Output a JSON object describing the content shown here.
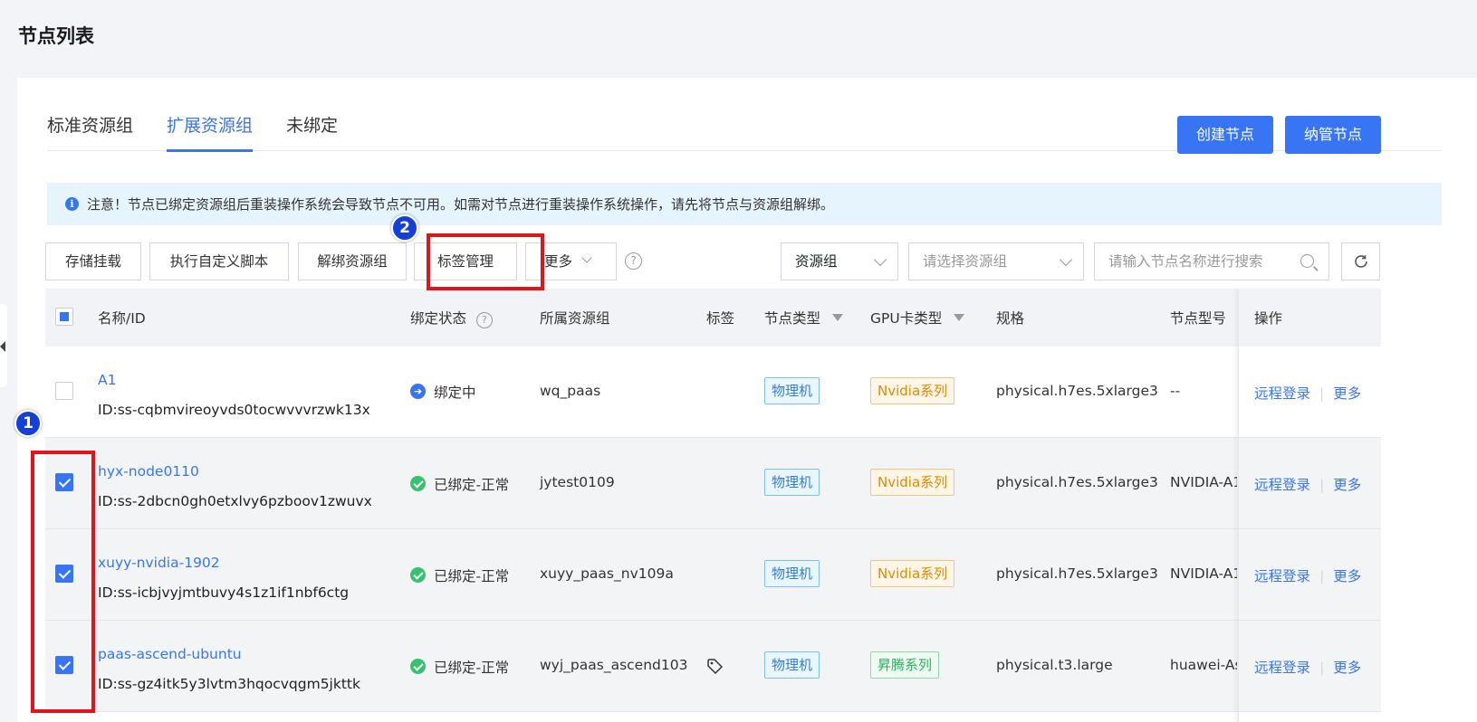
{
  "page_title": "节点列表",
  "tabs": [
    {
      "label": "标准资源组"
    },
    {
      "label": "扩展资源组"
    },
    {
      "label": "未绑定"
    }
  ],
  "header_buttons": {
    "create": "创建节点",
    "manage": "纳管节点"
  },
  "notice": "注意！节点已绑定资源组后重装操作系统会导致节点不可用。如需对节点进行重装操作系统操作，请先将节点与资源组解绑。",
  "toolbar": {
    "storage_mount": "存储挂载",
    "run_script": "执行自定义脚本",
    "unbind": "解绑资源组",
    "tag_manage": "标签管理",
    "more": "更多",
    "filter_select": "资源组",
    "group_placeholder": "请选择资源组",
    "search_placeholder": "请输入节点名称进行搜索"
  },
  "columns": {
    "name": "名称/ID",
    "bind_status": "绑定状态",
    "group": "所属资源组",
    "tags": "标签",
    "node_type": "节点类型",
    "gpu_type": "GPU卡类型",
    "spec": "规格",
    "model": "节点型号",
    "actions": "操作"
  },
  "rows": [
    {
      "name": "A1",
      "id": "ID:ss-cqbmvireoyvds0tocwvvvrzwk13x",
      "status": "绑定中",
      "group": "wq_paas",
      "node_type": "物理机",
      "gpu": "Nvidia系列",
      "spec": "physical.h7es.5xlarge3",
      "model": "--",
      "login": "远程登录",
      "more": "更多"
    },
    {
      "name": "hyx-node0110",
      "id": "ID:ss-2dbcn0gh0etxlvy6pzboov1zwuvx",
      "status": "已绑定-正常",
      "group": "jytest0109",
      "node_type": "物理机",
      "gpu": "Nvidia系列",
      "spec": "physical.h7es.5xlarge3",
      "model": "NVIDIA-A1",
      "login": "远程登录",
      "more": "更多"
    },
    {
      "name": "xuyy-nvidia-1902",
      "id": "ID:ss-icbjvyjmtbuvy4s1z1if1nbf6ctg",
      "status": "已绑定-正常",
      "group": "xuyy_paas_nv109a",
      "node_type": "物理机",
      "gpu": "Nvidia系列",
      "spec": "physical.h7es.5xlarge3",
      "model": "NVIDIA-A1",
      "login": "远程登录",
      "more": "更多"
    },
    {
      "name": "paas-ascend-ubuntu",
      "id": "ID:ss-gz4itk5y3lvtm3hqocvqgm5jkttk",
      "status": "已绑定-正常",
      "group": "wyj_paas_ascend103",
      "node_type": "物理机",
      "gpu": "昇腾系列",
      "spec": "physical.t3.large",
      "model": "huawei-Asc",
      "login": "远程登录",
      "more": "更多"
    }
  ],
  "annotations": {
    "step1": "1",
    "step2": "2"
  }
}
